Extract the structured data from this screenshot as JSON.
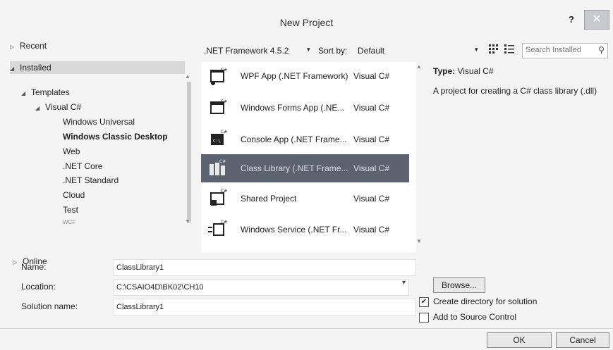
{
  "window": {
    "title": "New Project",
    "help_label": "?",
    "close_label": "✕"
  },
  "tree": {
    "recent": "Recent",
    "installed": "Installed",
    "templates": "Templates",
    "visual_csharp": "Visual C#",
    "items": [
      "Windows Universal",
      "Windows Classic Desktop",
      "Web",
      ".NET Core",
      ".NET Standard",
      "Cloud",
      "Test",
      "WCF"
    ],
    "selected_item": "Windows Classic Desktop",
    "online": "Online"
  },
  "toolbar": {
    "framework": ".NET Framework 4.5.2",
    "sort_label": "Sort by:",
    "sort_value": "Default",
    "search_placeholder": "Search Installed"
  },
  "templates": [
    {
      "name": "WPF App (.NET Framework)",
      "lang": "Visual C#",
      "icon": "wpf-app-icon"
    },
    {
      "name": "Windows Forms App (.NE...",
      "lang": "Visual C#",
      "icon": "windows-forms-icon"
    },
    {
      "name": "Console App (.NET Frame...",
      "lang": "Visual C#",
      "icon": "console-app-icon"
    },
    {
      "name": "Class Library (.NET Frame...",
      "lang": "Visual C#",
      "icon": "class-library-icon",
      "selected": true
    },
    {
      "name": "Shared Project",
      "lang": "Visual C#",
      "icon": "shared-project-icon"
    },
    {
      "name": "Windows Service (.NET Fr...",
      "lang": "Visual C#",
      "icon": "windows-service-icon"
    }
  ],
  "details": {
    "type_label": "Type:",
    "type_value": "Visual C#",
    "description": "A project for creating a C# class library (.dll)"
  },
  "form": {
    "name_label": "Name:",
    "name_value": "ClassLibrary1",
    "location_label": "Location:",
    "location_value": "C:\\CSAIO4D\\BK02\\CH10",
    "solution_label": "Solution name:",
    "solution_value": "ClassLibrary1",
    "browse_label": "Browse...",
    "create_dir_label": "Create directory for solution",
    "create_dir_checked": true,
    "source_control_label": "Add to Source Control",
    "source_control_checked": false,
    "ok_label": "OK",
    "cancel_label": "Cancel"
  }
}
